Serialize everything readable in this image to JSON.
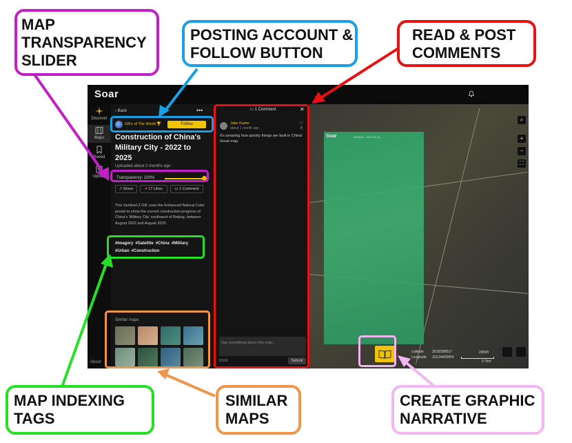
{
  "app": {
    "logo": "Soar",
    "nav": {
      "discover": "Discover",
      "maps": "Maps",
      "saved": "Saved",
      "upload": "Upload",
      "about": "About"
    },
    "map_info": {
      "back": "Back",
      "more": "•••",
      "account_name": "GIFs of The World",
      "follow_label": "Follow",
      "title": "Construction of China's Military City - 2022 to 2025",
      "uploaded": "Uploaded about 2 months ago",
      "transparency_label": "Transparency:",
      "transparency_value": "100%",
      "transparency_level": 1.0,
      "share_label": "Share",
      "likes_label": "17 Likes",
      "comments_label": "1 Comment",
      "description": "This Sentinel-2 GIF uses the Enhanced Natural Color preset to show the current construction progress of China's 'Military City' southwest of Beijing, between August 2022 and August 2025.",
      "tags": [
        "#Imagery",
        "#Satellite",
        "#China",
        "#Military",
        "#Urban",
        "#Construction"
      ],
      "similar_label": "Similar maps"
    },
    "comments_panel": {
      "header": "1 Comment",
      "close": "✕",
      "author": "Jake Karter",
      "time": "about 1 month ago",
      "like_count": "0",
      "text": "It's amazing how quickly things are built in China! Great map.",
      "input_placeholder": "Say something about this map...",
      "char_limit": "0/500",
      "submit_label": "Submit"
    },
    "map": {
      "gif_logo": "Soar",
      "gif_caption": "Sentinel - 2022-09-16",
      "latitude_label": "Latitude",
      "latitude_value": "39.82398517",
      "longitude_label": "Longitude",
      "longitude_value": "116.04402654",
      "scale_ft": "2000ft",
      "scale_km": "0.7km"
    }
  },
  "callouts": {
    "transparency": "MAP TRANSPARENCY SLIDER",
    "account": "POSTING ACCOUNT & FOLLOW BUTTON",
    "comments": "READ & POST COMMENTS",
    "tags": "MAP INDEXING TAGS",
    "similar": "SIMILAR MAPS",
    "narrative": "CREATE GRAPHIC NARRATIVE"
  },
  "colors": {
    "magenta": "#c21fc8",
    "blue": "#1aa0e6",
    "red": "#e81010",
    "green": "#26e026",
    "orange": "#f0954a",
    "pink": "#f4b6f0",
    "accent": "#f2c400"
  },
  "icons": [
    "compass-icon",
    "map-icon",
    "bookmark-icon",
    "upload-icon",
    "bell-icon",
    "share-icon",
    "heart-icon",
    "comment-icon",
    "search-icon",
    "zoom-in-icon",
    "zoom-out-icon",
    "fullscreen-icon",
    "book-icon",
    "layers-icon"
  ]
}
